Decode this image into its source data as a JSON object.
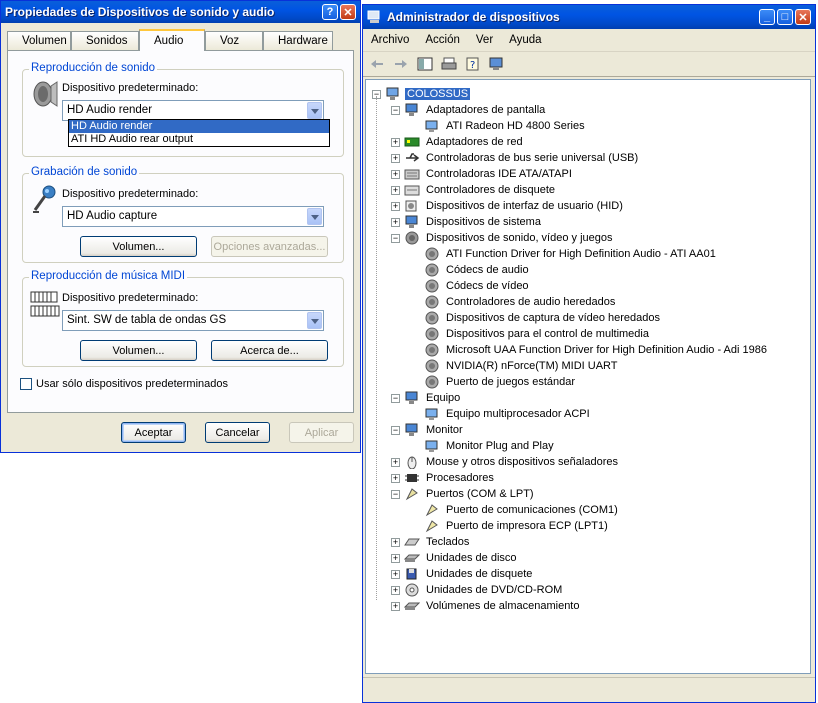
{
  "sound_dialog": {
    "title": "Propiedades de Dispositivos de sonido y audio",
    "help_label": "?",
    "close_label": "✕",
    "tabs": [
      "Volumen",
      "Sonidos",
      "Audio",
      "Voz",
      "Hardware"
    ],
    "active_tab": "Audio",
    "playback": {
      "group_title": "Reproducción de sonido",
      "label": "Dispositivo predeterminado:",
      "selected": "HD Audio render",
      "options": [
        "HD Audio render",
        "ATI HD Audio rear output"
      ]
    },
    "recording": {
      "group_title": "Grabación de sonido",
      "label": "Dispositivo predeterminado:",
      "selected": "HD Audio capture",
      "volume_button": "Volumen...",
      "advanced_button": "Opciones avanzadas..."
    },
    "midi": {
      "group_title": "Reproducción de música MIDI",
      "label": "Dispositivo predeterminado:",
      "selected": "Sint. SW de tabla de ondas GS",
      "volume_button": "Volumen...",
      "about_button": "Acerca de..."
    },
    "only_default_label": "Usar sólo dispositivos predeterminados",
    "ok_button": "Aceptar",
    "cancel_button": "Cancelar",
    "apply_button": "Aplicar"
  },
  "device_manager": {
    "title": "Administrador de dispositivos",
    "menu": [
      "Archivo",
      "Acción",
      "Ver",
      "Ayuda"
    ],
    "root": "COLOSSUS",
    "tree": [
      {
        "label": "Adaptadores de pantalla",
        "expanded": true,
        "icon": "monitor-icon",
        "children": [
          "ATI Radeon HD 4800 Series"
        ]
      },
      {
        "label": "Adaptadores de red",
        "expanded": false,
        "icon": "network-card-icon",
        "children": []
      },
      {
        "label": "Controladoras de bus serie universal (USB)",
        "expanded": false,
        "icon": "usb-icon",
        "children": []
      },
      {
        "label": "Controladoras IDE ATA/ATAPI",
        "expanded": false,
        "icon": "ide-controller-icon",
        "children": []
      },
      {
        "label": "Controladores de disquete",
        "expanded": false,
        "icon": "floppy-controller-icon",
        "children": []
      },
      {
        "label": "Dispositivos de interfaz de usuario (HID)",
        "expanded": false,
        "icon": "hid-icon",
        "children": []
      },
      {
        "label": "Dispositivos de sistema",
        "expanded": false,
        "icon": "system-icon",
        "children": []
      },
      {
        "label": "Dispositivos de sonido, vídeo y juegos",
        "expanded": true,
        "icon": "speaker-icon",
        "children": [
          "ATI Function Driver for High Definition Audio - ATI AA01",
          "Códecs de audio",
          "Códecs de vídeo",
          "Controladores de audio heredados",
          "Dispositivos de captura de vídeo heredados",
          "Dispositivos para el control de multimedia",
          "Microsoft UAA Function Driver for High Definition Audio - Adi 1986",
          "NVIDIA(R) nForce(TM) MIDI UART",
          "Puerto de juegos estándar"
        ]
      },
      {
        "label": "Equipo",
        "expanded": true,
        "icon": "computer-icon",
        "children": [
          "Equipo multiprocesador ACPI"
        ]
      },
      {
        "label": "Monitor",
        "expanded": true,
        "icon": "monitor-icon",
        "children": [
          "Monitor Plug and Play"
        ]
      },
      {
        "label": "Mouse y otros dispositivos señaladores",
        "expanded": false,
        "icon": "mouse-icon",
        "children": []
      },
      {
        "label": "Procesadores",
        "expanded": false,
        "icon": "processor-icon",
        "children": []
      },
      {
        "label": "Puertos (COM & LPT)",
        "expanded": true,
        "icon": "port-icon",
        "children": [
          "Puerto de comunicaciones (COM1)",
          "Puerto de impresora ECP (LPT1)"
        ]
      },
      {
        "label": "Teclados",
        "expanded": false,
        "icon": "keyboard-icon",
        "children": []
      },
      {
        "label": "Unidades de disco",
        "expanded": false,
        "icon": "disk-drive-icon",
        "children": []
      },
      {
        "label": "Unidades de disquete",
        "expanded": false,
        "icon": "floppy-icon",
        "children": []
      },
      {
        "label": "Unidades de DVD/CD-ROM",
        "expanded": false,
        "icon": "dvd-icon",
        "children": []
      },
      {
        "label": "Volúmenes de almacenamiento",
        "expanded": false,
        "icon": "storage-volume-icon",
        "children": []
      }
    ]
  }
}
